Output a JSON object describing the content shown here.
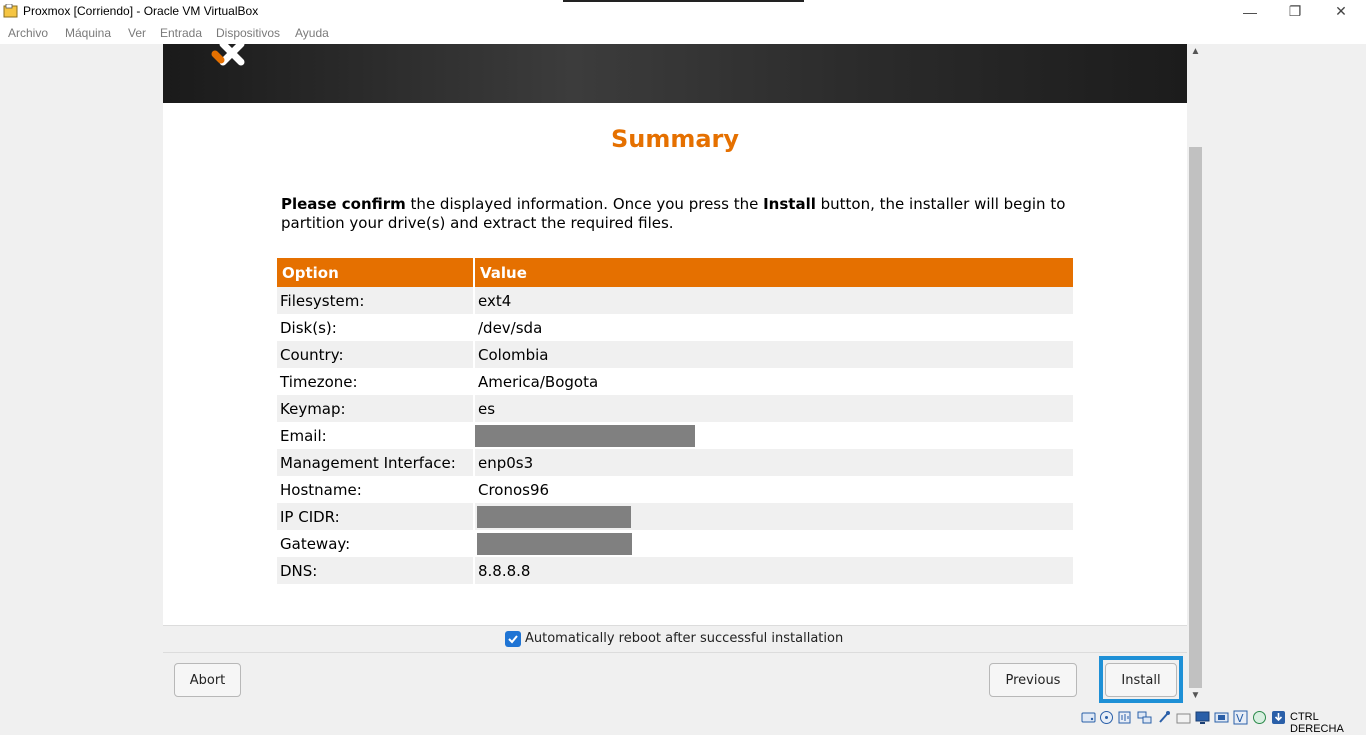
{
  "window": {
    "title": "Proxmox [Corriendo] - Oracle VM VirtualBox",
    "controls": {
      "minimize": "—",
      "restore": "❐",
      "close": "✕"
    }
  },
  "menu": [
    "Archivo",
    "Máquina",
    "Ver",
    "Entrada",
    "Dispositivos",
    "Ayuda"
  ],
  "installer": {
    "title": "Summary",
    "intro": {
      "bold1": "Please confirm",
      "text1": " the displayed information. Once you press the ",
      "bold2": "Install",
      "text2": " button, the installer will begin to partition your drive(s) and extract the required files."
    },
    "table": {
      "headers": [
        "Option",
        "Value"
      ],
      "rows": [
        {
          "option": "Filesystem:",
          "value": "ext4"
        },
        {
          "option": "Disk(s):",
          "value": "/dev/sda"
        },
        {
          "option": "Country:",
          "value": "Colombia"
        },
        {
          "option": "Timezone:",
          "value": "America/Bogota"
        },
        {
          "option": "Keymap:",
          "value": "es"
        },
        {
          "option": "Email:",
          "value": ""
        },
        {
          "option": "Management Interface:",
          "value": "enp0s3"
        },
        {
          "option": "Hostname:",
          "value": "Cronos96"
        },
        {
          "option": "IP CIDR:",
          "value": ""
        },
        {
          "option": "Gateway:",
          "value": ""
        },
        {
          "option": "DNS:",
          "value": "8.8.8.8"
        }
      ]
    },
    "reboot_checkbox": {
      "label": "Automatically reboot after successful installation",
      "checked": true
    },
    "buttons": {
      "abort": "Abort",
      "previous": "Previous",
      "install": "Install"
    },
    "accent_color": "#e57000"
  },
  "statusbar": {
    "host_key": "CTRL DERECHA"
  }
}
